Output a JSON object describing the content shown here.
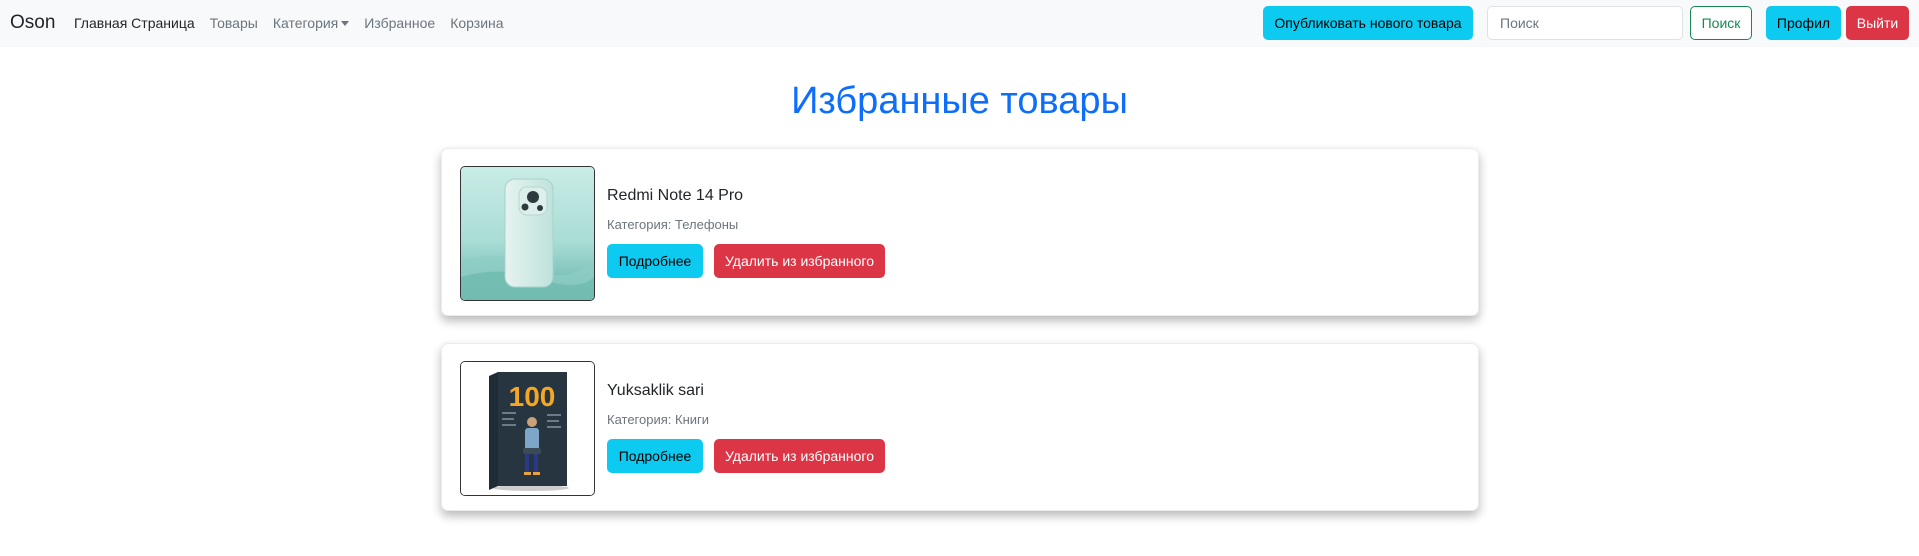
{
  "navbar": {
    "brand": "Oson",
    "links": [
      {
        "label": "Главная Страница"
      },
      {
        "label": "Товары"
      },
      {
        "label": "Категория"
      },
      {
        "label": "Избранное"
      },
      {
        "label": "Корзина"
      }
    ],
    "publish_label": "Опубликовать нового товара",
    "search_placeholder": "Поиск",
    "search_button": "Поиск",
    "profile_label": "Профил",
    "logout_label": "Выйти"
  },
  "page": {
    "title": "Избранные товары"
  },
  "favorites": [
    {
      "name": "Redmi Note 14 Pro",
      "category": "Категория: Телефоны",
      "details_label": "Подробнее",
      "remove_label": "Удалить из избранного"
    },
    {
      "name": "Yuksaklik sari",
      "category": "Категория: Книги",
      "details_label": "Подробнее",
      "remove_label": "Удалить из избранного",
      "image_text": "100"
    }
  ],
  "colors": {
    "info": "#0dcaf0",
    "danger": "#dc3545",
    "success": "#198754",
    "primary": "#0d6efd"
  }
}
